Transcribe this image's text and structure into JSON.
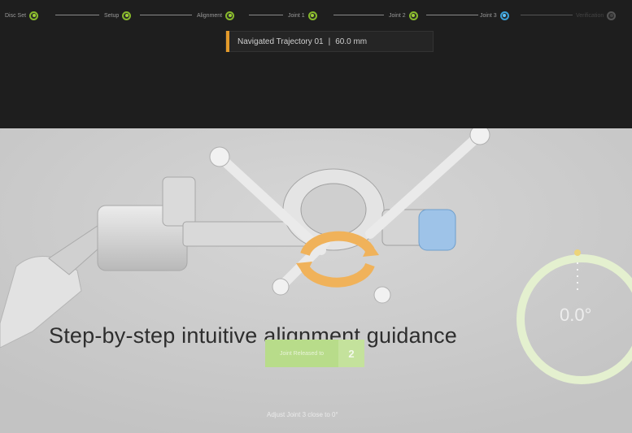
{
  "stepper": {
    "steps": [
      {
        "label": "Disc Set",
        "state": "done"
      },
      {
        "label": "Setup",
        "state": "done"
      },
      {
        "label": "Alignment",
        "state": "done"
      },
      {
        "label": "Joint 1",
        "state": "done"
      },
      {
        "label": "Joint 2",
        "state": "done"
      },
      {
        "label": "Joint 3",
        "state": "active"
      },
      {
        "label": "Verification",
        "state": "pending"
      }
    ]
  },
  "trajectory": {
    "name": "Navigated Trajectory 01",
    "separator": "|",
    "depth": "60.0 mm"
  },
  "headline": "Step-by-step intuitive alignment guidance",
  "action_button": {
    "label": "Joint Released to",
    "count": "2"
  },
  "hint": "Adjust Joint 3 close to 0°",
  "gauge": {
    "value": "0.0°"
  },
  "colors": {
    "done": "#86b82b",
    "active": "#3aa0d8",
    "accent": "#e39a2a",
    "rotation_ring": "#f0b25a"
  }
}
